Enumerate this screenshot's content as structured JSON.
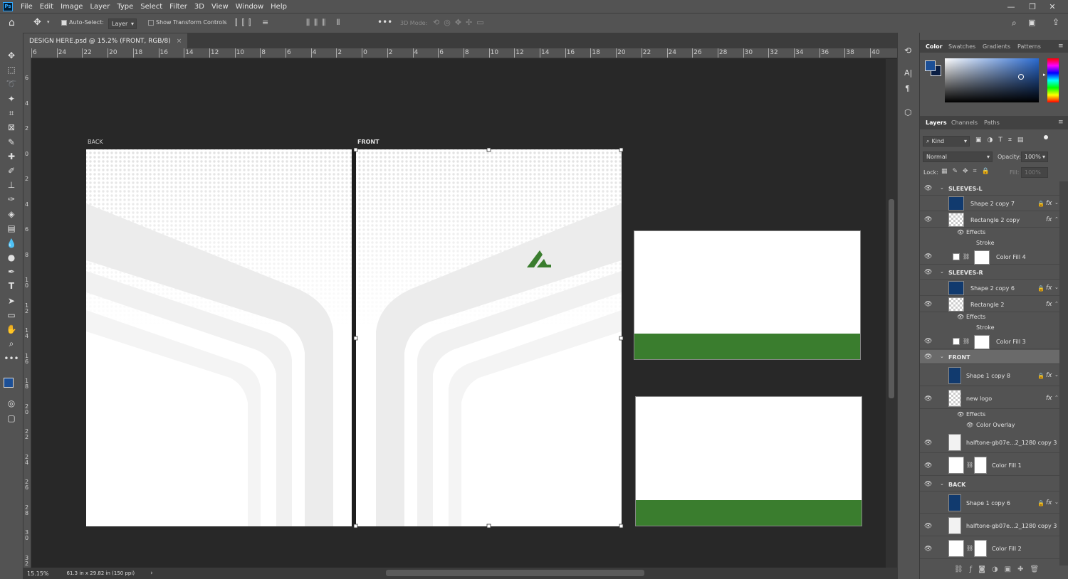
{
  "app": {
    "logo": "Ps"
  },
  "menu": [
    "File",
    "Edit",
    "Image",
    "Layer",
    "Type",
    "Select",
    "Filter",
    "3D",
    "View",
    "Window",
    "Help"
  ],
  "options": {
    "auto_select_label": "Auto-Select:",
    "auto_select_checked": true,
    "auto_select_target": "Layer",
    "show_transform_label": "Show Transform Controls",
    "mode_3d_label": "3D Mode:"
  },
  "document": {
    "tab_title": "DESIGN HERE.psd @ 15.2% (FRONT, RGB/8)",
    "close": "×"
  },
  "ruler": {
    "h_ticks": [
      "6",
      "24",
      "22",
      "20",
      "18",
      "16",
      "14",
      "12",
      "10",
      "8",
      "6",
      "4",
      "2",
      "0",
      "2",
      "4",
      "6",
      "8",
      "10",
      "12",
      "14",
      "16",
      "18",
      "20",
      "22",
      "24",
      "26",
      "28",
      "30",
      "32",
      "34",
      "36",
      "38",
      "40"
    ],
    "v_ticks": [
      "6",
      "4",
      "2",
      "0",
      "2",
      "4",
      "6",
      "8",
      "10",
      "12",
      "14",
      "16",
      "18",
      "20",
      "22",
      "24",
      "26",
      "28",
      "30",
      "32"
    ]
  },
  "canvas": {
    "back_label": "BACK",
    "front_label": "FRONT",
    "logo_color": "#3a7d2e",
    "sleeve_stripe_color": "#3a7d2e"
  },
  "status": {
    "zoom": "15.15%",
    "doc_size": "61.3 in x 29.82 in (150 ppi)"
  },
  "color_panel": {
    "tabs": [
      "Color",
      "Swatches",
      "Gradients",
      "Patterns"
    ],
    "foreground": "#1c4f96",
    "background": "#0b1f44"
  },
  "layers_panel": {
    "tabs": [
      "Layers",
      "Channels",
      "Paths"
    ],
    "filter_kind": "Kind",
    "blend_mode": "Normal",
    "opacity_label": "Opacity:",
    "opacity_value": "100%",
    "lock_label": "Lock:",
    "fill_label": "Fill:",
    "fill_value": "100%",
    "rows": {
      "g1": "SLEEVES-L",
      "r1": "Shape 2 copy 7",
      "r2": "Rectangle 2 copy",
      "r2e": "Effects",
      "r2s": "Stroke",
      "r3": "Color Fill 4",
      "g2": "SLEEVES-R",
      "r4": "Shape 2 copy 6",
      "r5": "Rectangle 2",
      "r5e": "Effects",
      "r5s": "Stroke",
      "r6": "Color Fill 3",
      "g3": "FRONT",
      "r7": "Shape 1 copy 8",
      "r8": "new logo",
      "r8e": "Effects",
      "r8s": "Color Overlay",
      "r9": "halftone-gb07e...2_1280 copy 3",
      "r10": "Color Fill 1",
      "g4": "BACK",
      "r11": "Shape 1 copy 6",
      "r12": "halftone-gb07e...2_1280 copy 3",
      "r13": "Color Fill 2"
    },
    "fx": "fx"
  }
}
